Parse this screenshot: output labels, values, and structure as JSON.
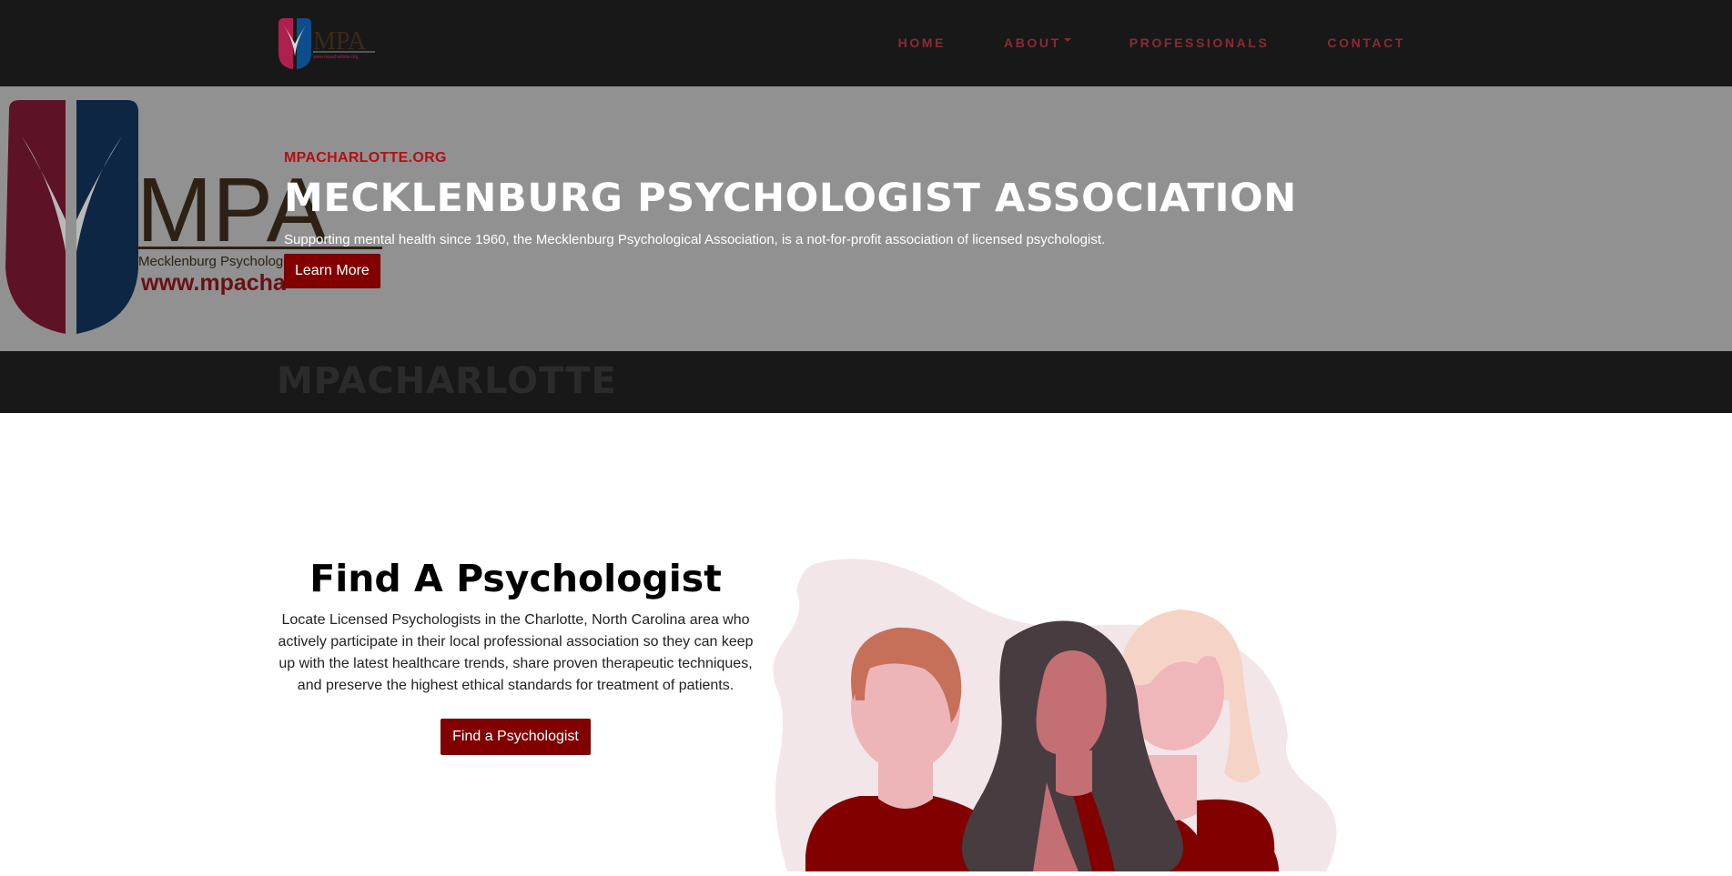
{
  "nav": {
    "logo_text": "MPA",
    "logo_url_text": "www.mpacharlotte.org",
    "items": [
      {
        "label": "HOME"
      },
      {
        "label": "ABOUT"
      },
      {
        "label": "PROFESSIONALS"
      },
      {
        "label": "CONTACT"
      }
    ]
  },
  "hero": {
    "bg_logo_text": "MPA",
    "bg_logo_subtitle": "Mecklenburg Psychological Association",
    "bg_logo_url": "www.mpacha",
    "eyebrow": "MPACHARLOTTE.ORG",
    "title": "MECKLENBURG PSYCHOLOGIST ASSOCIATION",
    "text": "Supporting mental health since 1960, the Mecklenburg Psychological Association, is a not-for-profit association of licensed psychologist.",
    "button_label": "Learn More"
  },
  "band": {
    "text": "MPACHARLOTTE"
  },
  "find": {
    "title": "Find A Psychologist",
    "text": "Locate Licensed Psychologists in the Charlotte, North Carolina area who actively participate in their local professional association so they can keep up with the latest healthcare trends, share proven therapeutic techniques, and preserve the highest ethical standards for treatment of patients.",
    "button_label": "Find a Psychologist"
  },
  "colors": {
    "nav_bg": "#181818",
    "nav_link": "#8c2a35",
    "hero_bg": "#919191",
    "accent_red": "#820000",
    "eyebrow_red": "#b30f15"
  }
}
